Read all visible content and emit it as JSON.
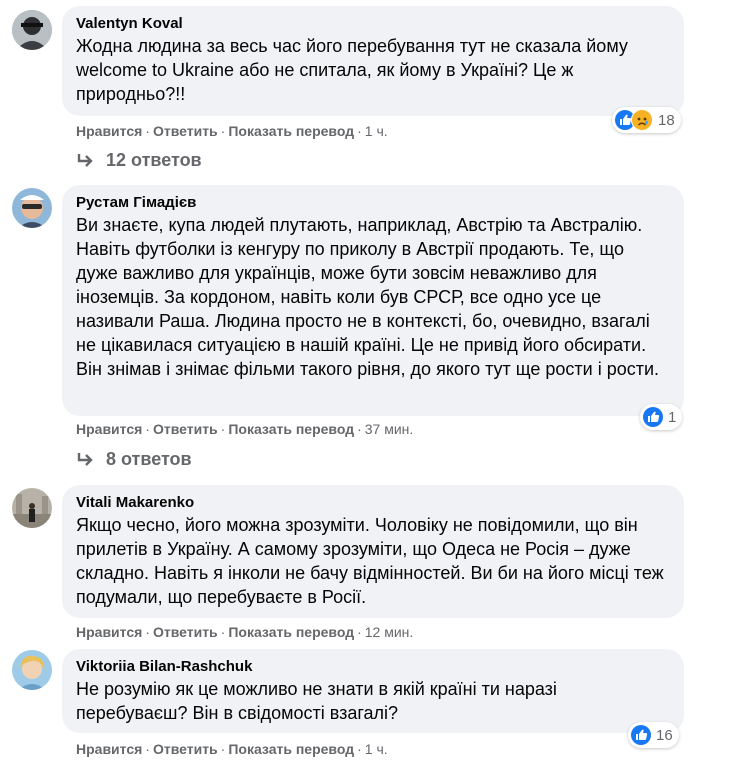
{
  "actions": {
    "like": "Нравится",
    "reply": "Ответить",
    "translate": "Показать перевод"
  },
  "comments": [
    {
      "author": "Valentyn Koval",
      "text": "Жодна людина за весь час його перебування тут не сказала йому welcome to Ukraine або не спитала, як йому в Україні? Це ж природньо?!!",
      "time": "1 ч.",
      "reaction_count": "18",
      "reactions": [
        "like-icon",
        "sad-icon"
      ],
      "replies": "12 ответов"
    },
    {
      "author": "Рустам Гімадієв",
      "text": "Ви знаєте, купа людей плутають, наприклад, Австрію та Австралію. Навіть футболки із кенгуру по приколу в Австрії продають. Те, що дуже важливо для українців, може бути зовсім неважливо для іноземців. За кордоном, навіть коли був СРСР, все одно усе це називали Раша. Людина просто не в контексті, бо, очевидно, взагалі не цікавилася ситуацією в нашій країні. Це не привід його обсирати. Він знімав і знімає фільми такого рівня, до якого тут ще рости і рости.",
      "time": "37 мин.",
      "reaction_count": "1",
      "reactions": [
        "like-icon"
      ],
      "replies": "8 ответов"
    },
    {
      "author": "Vitali Makarenko",
      "text": "Якщо чесно, його можна зрозуміти. Чоловіку не повідомили, що він прилетів в Україну. А самому зрозуміти, що Одеса не Росія – дуже складно. Навіть я інколи не бачу відмінностей. Ви би на його місці теж подумали, що перебуваєте в Росії.",
      "time": "12 мин."
    },
    {
      "author": "Viktoriia Bilan-Rashchuk",
      "text": "Не розумію як це можливо не знати в якій країні ти наразі перебуваєш? Він в свідомості взагалі?",
      "time": "1 ч.",
      "reaction_count": "16",
      "reactions": [
        "like-icon"
      ]
    }
  ],
  "colors": {
    "bubble": "#f0f2f5",
    "secondary_text": "#65676b",
    "like": "#1877f2",
    "sad": "#f7b125"
  }
}
